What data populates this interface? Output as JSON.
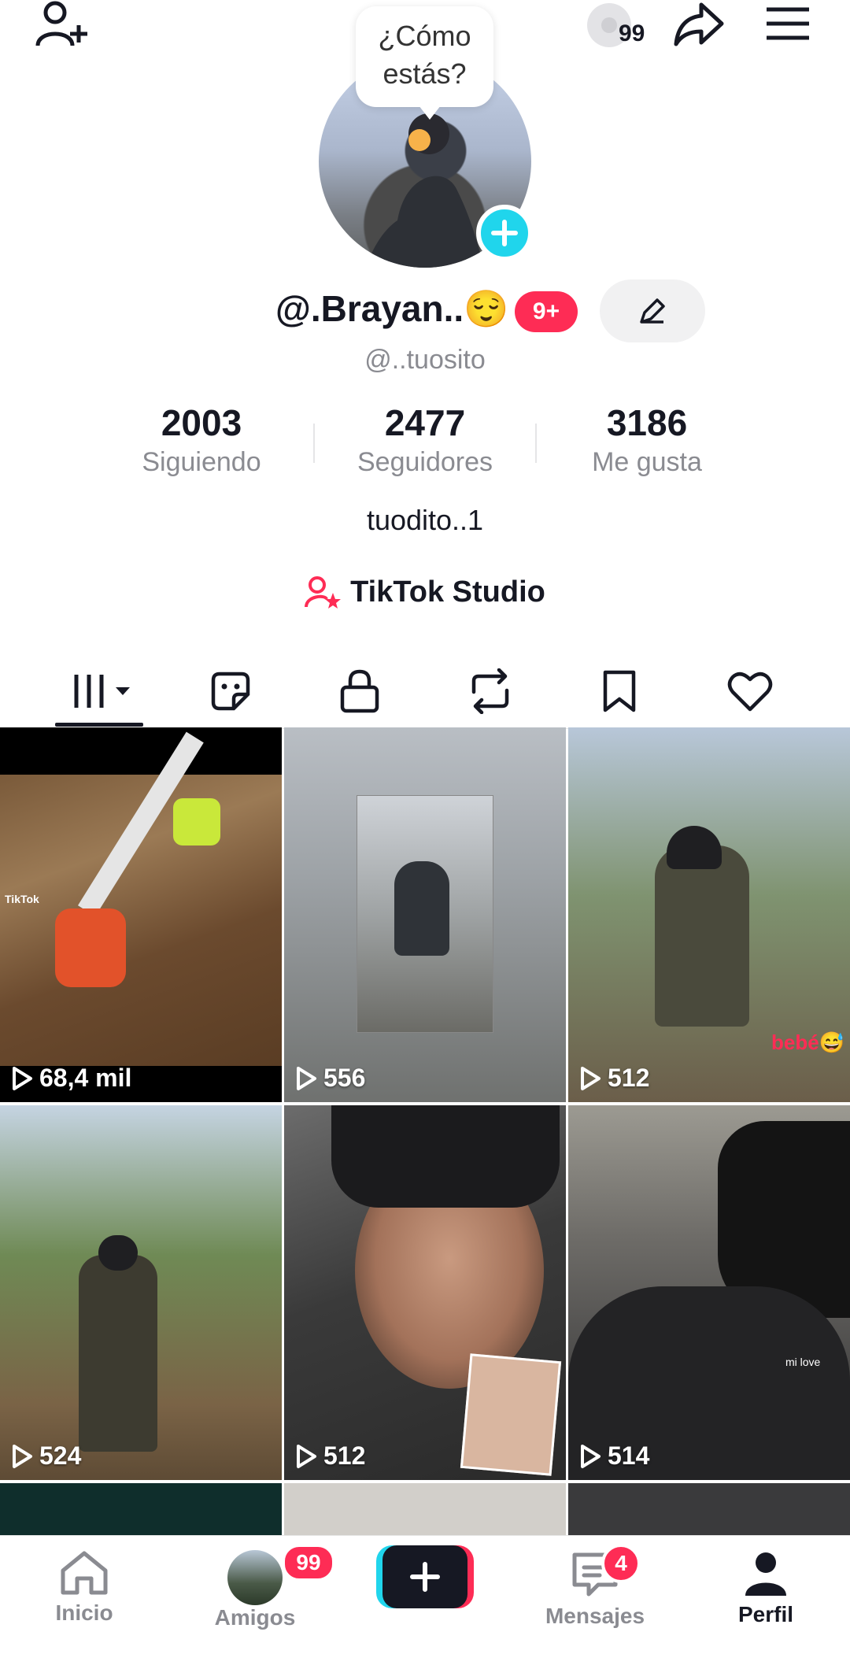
{
  "topbar": {
    "music_count": "99"
  },
  "bubble": {
    "line1": "¿Cómo",
    "line2": "estás?"
  },
  "profile": {
    "display_name": "@.Brayan..😌",
    "notif_badge": "9+",
    "handle": "@..tuosito",
    "bio": "tuodito..1"
  },
  "stats": [
    {
      "value": "2003",
      "label": "Siguiendo"
    },
    {
      "value": "2477",
      "label": "Seguidores"
    },
    {
      "value": "3186",
      "label": "Me gusta"
    }
  ],
  "studio": {
    "label": "TikTok Studio"
  },
  "videos": [
    {
      "views": "68,4 mil"
    },
    {
      "views": "556"
    },
    {
      "views": "512"
    },
    {
      "views": "524"
    },
    {
      "views": "512"
    },
    {
      "views": "514"
    }
  ],
  "video_overlay_text": {
    "tiktok_watermark": "TikTok",
    "bebe": "bebé😅",
    "mi_love": "mi love"
  },
  "nav": {
    "inicio": "Inicio",
    "amigos": "Amigos",
    "amigos_badge": "99",
    "mensajes": "Mensajes",
    "mensajes_badge": "4",
    "perfil": "Perfil"
  },
  "colors": {
    "accent": "#fe2c55",
    "cyan": "#20d5ec",
    "text": "#161823",
    "muted": "#8a8b91"
  }
}
